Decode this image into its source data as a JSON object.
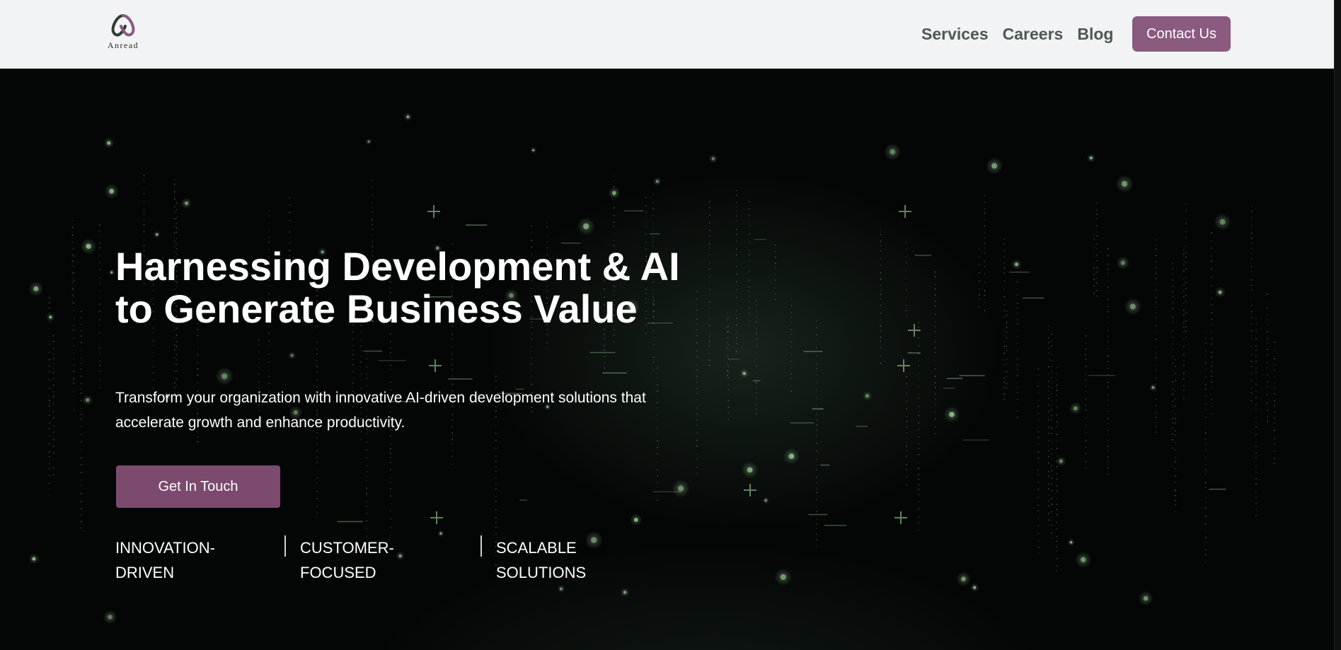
{
  "brand": {
    "name": "Anread",
    "logo_icon": "anread-logo-icon"
  },
  "nav": {
    "items": [
      {
        "label": "Services"
      },
      {
        "label": "Careers"
      },
      {
        "label": "Blog"
      }
    ],
    "contact_label": "Contact Us"
  },
  "hero": {
    "title": "Harnessing Development & AI to Generate Business Value",
    "subtitle": "Transform your organization with innovative AI-driven development solutions that accelerate growth and enhance productivity.",
    "cta_label": "Get In Touch",
    "features": [
      {
        "line1": "INNOVATION-",
        "line2": "DRIVEN"
      },
      {
        "line1": "CUSTOMER-",
        "line2": "FOCUSED"
      },
      {
        "line1": "SCALABLE",
        "line2": "SOLUTIONS"
      }
    ]
  },
  "colors": {
    "nav_background": "#f2f3f5",
    "nav_text": "#4c5a52",
    "accent": "#8a5a7f",
    "cta": "#7b4a6e",
    "hero_background": "#040606",
    "particles": "#9fd29a"
  }
}
